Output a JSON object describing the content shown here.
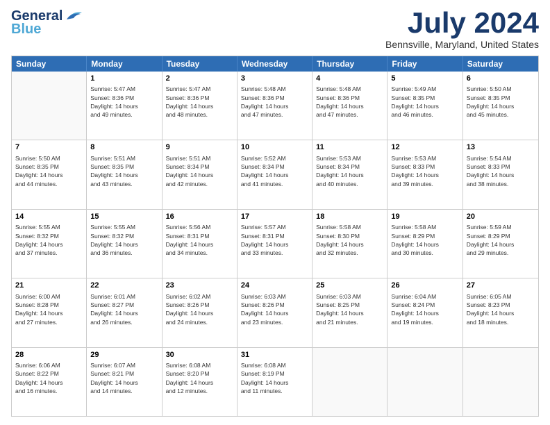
{
  "header": {
    "logo_line1": "General",
    "logo_line2": "Blue",
    "month_title": "July 2024",
    "location": "Bennsville, Maryland, United States"
  },
  "weekdays": [
    "Sunday",
    "Monday",
    "Tuesday",
    "Wednesday",
    "Thursday",
    "Friday",
    "Saturday"
  ],
  "rows": [
    [
      {
        "day": "",
        "info": ""
      },
      {
        "day": "1",
        "info": "Sunrise: 5:47 AM\nSunset: 8:36 PM\nDaylight: 14 hours\nand 49 minutes."
      },
      {
        "day": "2",
        "info": "Sunrise: 5:47 AM\nSunset: 8:36 PM\nDaylight: 14 hours\nand 48 minutes."
      },
      {
        "day": "3",
        "info": "Sunrise: 5:48 AM\nSunset: 8:36 PM\nDaylight: 14 hours\nand 47 minutes."
      },
      {
        "day": "4",
        "info": "Sunrise: 5:48 AM\nSunset: 8:36 PM\nDaylight: 14 hours\nand 47 minutes."
      },
      {
        "day": "5",
        "info": "Sunrise: 5:49 AM\nSunset: 8:35 PM\nDaylight: 14 hours\nand 46 minutes."
      },
      {
        "day": "6",
        "info": "Sunrise: 5:50 AM\nSunset: 8:35 PM\nDaylight: 14 hours\nand 45 minutes."
      }
    ],
    [
      {
        "day": "7",
        "info": "Sunrise: 5:50 AM\nSunset: 8:35 PM\nDaylight: 14 hours\nand 44 minutes."
      },
      {
        "day": "8",
        "info": "Sunrise: 5:51 AM\nSunset: 8:35 PM\nDaylight: 14 hours\nand 43 minutes."
      },
      {
        "day": "9",
        "info": "Sunrise: 5:51 AM\nSunset: 8:34 PM\nDaylight: 14 hours\nand 42 minutes."
      },
      {
        "day": "10",
        "info": "Sunrise: 5:52 AM\nSunset: 8:34 PM\nDaylight: 14 hours\nand 41 minutes."
      },
      {
        "day": "11",
        "info": "Sunrise: 5:53 AM\nSunset: 8:34 PM\nDaylight: 14 hours\nand 40 minutes."
      },
      {
        "day": "12",
        "info": "Sunrise: 5:53 AM\nSunset: 8:33 PM\nDaylight: 14 hours\nand 39 minutes."
      },
      {
        "day": "13",
        "info": "Sunrise: 5:54 AM\nSunset: 8:33 PM\nDaylight: 14 hours\nand 38 minutes."
      }
    ],
    [
      {
        "day": "14",
        "info": "Sunrise: 5:55 AM\nSunset: 8:32 PM\nDaylight: 14 hours\nand 37 minutes."
      },
      {
        "day": "15",
        "info": "Sunrise: 5:55 AM\nSunset: 8:32 PM\nDaylight: 14 hours\nand 36 minutes."
      },
      {
        "day": "16",
        "info": "Sunrise: 5:56 AM\nSunset: 8:31 PM\nDaylight: 14 hours\nand 34 minutes."
      },
      {
        "day": "17",
        "info": "Sunrise: 5:57 AM\nSunset: 8:31 PM\nDaylight: 14 hours\nand 33 minutes."
      },
      {
        "day": "18",
        "info": "Sunrise: 5:58 AM\nSunset: 8:30 PM\nDaylight: 14 hours\nand 32 minutes."
      },
      {
        "day": "19",
        "info": "Sunrise: 5:58 AM\nSunset: 8:29 PM\nDaylight: 14 hours\nand 30 minutes."
      },
      {
        "day": "20",
        "info": "Sunrise: 5:59 AM\nSunset: 8:29 PM\nDaylight: 14 hours\nand 29 minutes."
      }
    ],
    [
      {
        "day": "21",
        "info": "Sunrise: 6:00 AM\nSunset: 8:28 PM\nDaylight: 14 hours\nand 27 minutes."
      },
      {
        "day": "22",
        "info": "Sunrise: 6:01 AM\nSunset: 8:27 PM\nDaylight: 14 hours\nand 26 minutes."
      },
      {
        "day": "23",
        "info": "Sunrise: 6:02 AM\nSunset: 8:26 PM\nDaylight: 14 hours\nand 24 minutes."
      },
      {
        "day": "24",
        "info": "Sunrise: 6:03 AM\nSunset: 8:26 PM\nDaylight: 14 hours\nand 23 minutes."
      },
      {
        "day": "25",
        "info": "Sunrise: 6:03 AM\nSunset: 8:25 PM\nDaylight: 14 hours\nand 21 minutes."
      },
      {
        "day": "26",
        "info": "Sunrise: 6:04 AM\nSunset: 8:24 PM\nDaylight: 14 hours\nand 19 minutes."
      },
      {
        "day": "27",
        "info": "Sunrise: 6:05 AM\nSunset: 8:23 PM\nDaylight: 14 hours\nand 18 minutes."
      }
    ],
    [
      {
        "day": "28",
        "info": "Sunrise: 6:06 AM\nSunset: 8:22 PM\nDaylight: 14 hours\nand 16 minutes."
      },
      {
        "day": "29",
        "info": "Sunrise: 6:07 AM\nSunset: 8:21 PM\nDaylight: 14 hours\nand 14 minutes."
      },
      {
        "day": "30",
        "info": "Sunrise: 6:08 AM\nSunset: 8:20 PM\nDaylight: 14 hours\nand 12 minutes."
      },
      {
        "day": "31",
        "info": "Sunrise: 6:08 AM\nSunset: 8:19 PM\nDaylight: 14 hours\nand 11 minutes."
      },
      {
        "day": "",
        "info": ""
      },
      {
        "day": "",
        "info": ""
      },
      {
        "day": "",
        "info": ""
      }
    ]
  ]
}
